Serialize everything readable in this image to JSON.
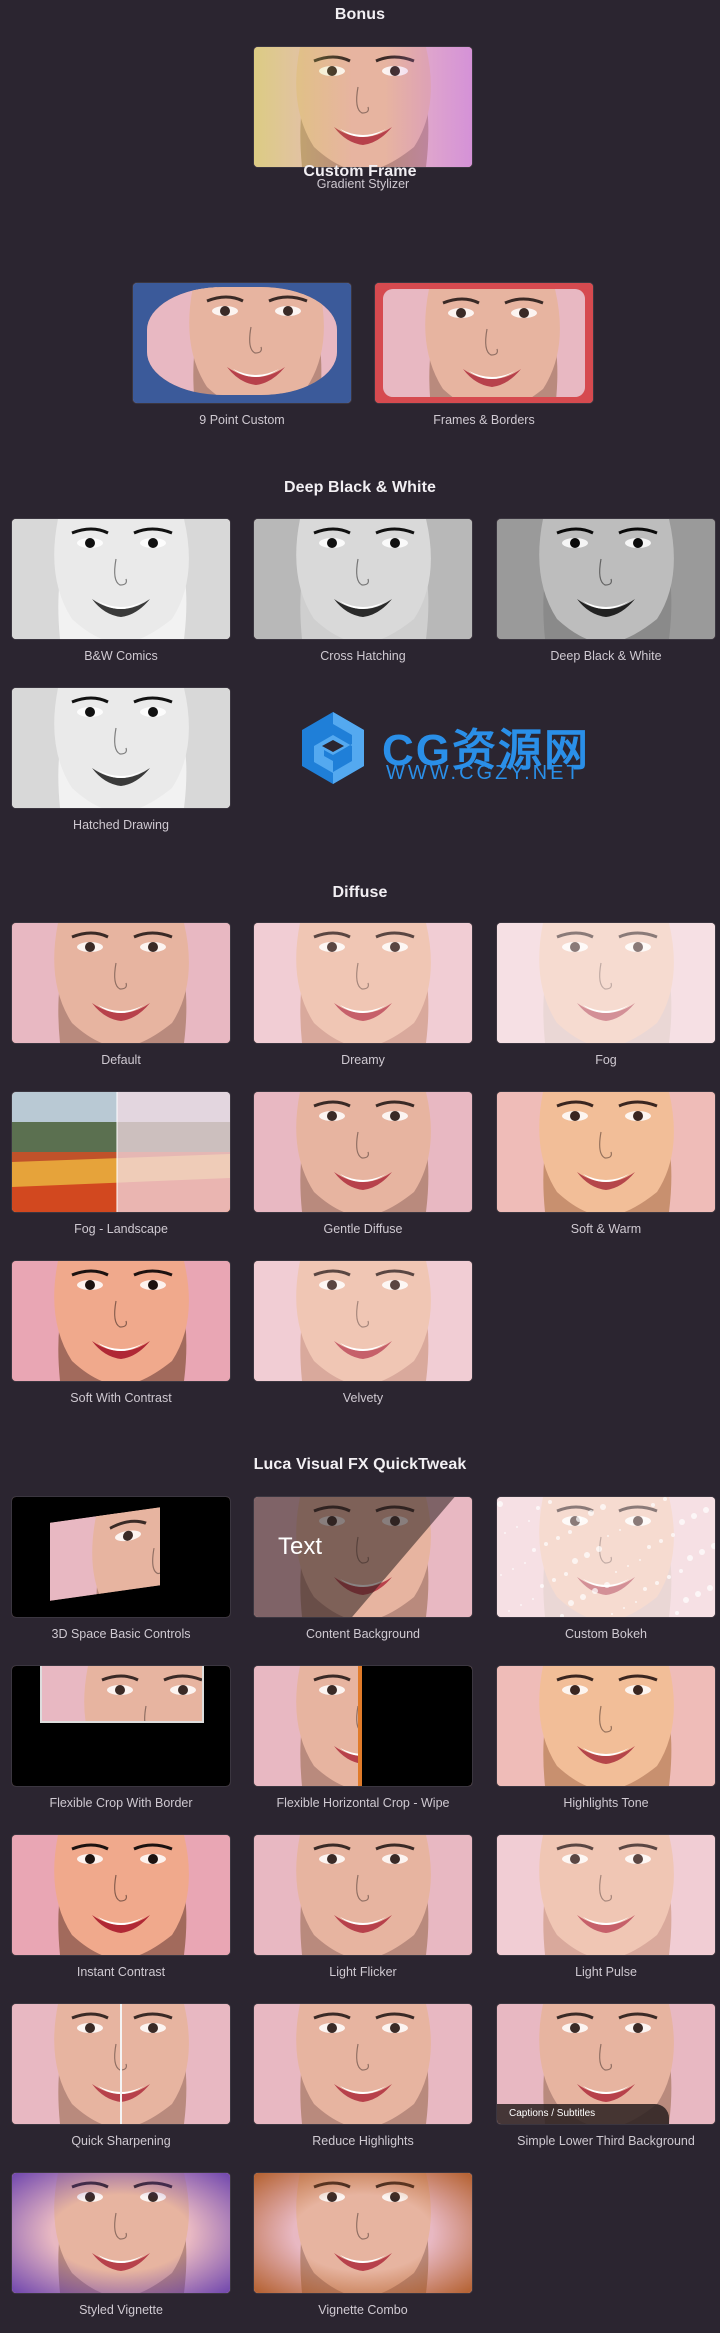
{
  "sections": [
    {
      "title": "Bonus",
      "items": [
        {
          "label": "Gradient Stylizer",
          "style": "gradient"
        }
      ]
    },
    {
      "title": "Custom Frame",
      "items": [
        {
          "label": "9 Point Custom",
          "style": "blueframe"
        },
        {
          "label": "Frames & Borders",
          "style": "redframe"
        }
      ]
    },
    {
      "title": "Deep Black & White",
      "items": [
        {
          "label": "B&W Comics",
          "style": "bw"
        },
        {
          "label": "Cross Hatching",
          "style": "bw2"
        },
        {
          "label": "Deep Black & White",
          "style": "bw3"
        },
        {
          "label": "Hatched Drawing",
          "style": "bw"
        }
      ]
    },
    {
      "title": "Diffuse",
      "items": [
        {
          "label": "Default",
          "style": "normal"
        },
        {
          "label": "Dreamy",
          "style": "soft"
        },
        {
          "label": "Fog",
          "style": "fog"
        },
        {
          "label": "Fog - Landscape",
          "style": "landscape"
        },
        {
          "label": "Gentle Diffuse",
          "style": "normal"
        },
        {
          "label": "Soft & Warm",
          "style": "warm"
        },
        {
          "label": "Soft With Contrast",
          "style": "contrast"
        },
        {
          "label": "Velvety",
          "style": "soft"
        }
      ]
    },
    {
      "title": "Luca Visual FX QuickTweak",
      "items": [
        {
          "label": "3D Space Basic Controls",
          "style": "space3d"
        },
        {
          "label": "Content Background",
          "style": "textbg"
        },
        {
          "label": "Custom Bokeh",
          "style": "bokeh"
        },
        {
          "label": "Flexible Crop With Border",
          "style": "cropborder"
        },
        {
          "label": "Flexible Horizontal Crop - Wipe",
          "style": "wipe"
        },
        {
          "label": "Highlights Tone",
          "style": "warm"
        },
        {
          "label": "Instant Contrast",
          "style": "contrast"
        },
        {
          "label": "Light Flicker",
          "style": "normal"
        },
        {
          "label": "Light Pulse",
          "style": "soft"
        },
        {
          "label": "Quick Sharpening",
          "style": "sharpen"
        },
        {
          "label": "Reduce Highlights",
          "style": "normal"
        },
        {
          "label": "Simple Lower Third Background",
          "style": "lowerthird"
        },
        {
          "label": "Styled Vignette",
          "style": "purplevig"
        },
        {
          "label": "Vignette Combo",
          "style": "orangevig"
        }
      ]
    }
  ],
  "overlay": {
    "content_text": "Text",
    "caption_text": "Captions / Subtitles"
  },
  "watermark": {
    "brand": "CG资源网",
    "url": "WWW.CGZY.NET"
  },
  "colors": {
    "background": "#2b2530",
    "accent_blue": "#2a8fe8",
    "frame_red": "#d64a4f",
    "frame_blue": "#3b5a9a"
  }
}
